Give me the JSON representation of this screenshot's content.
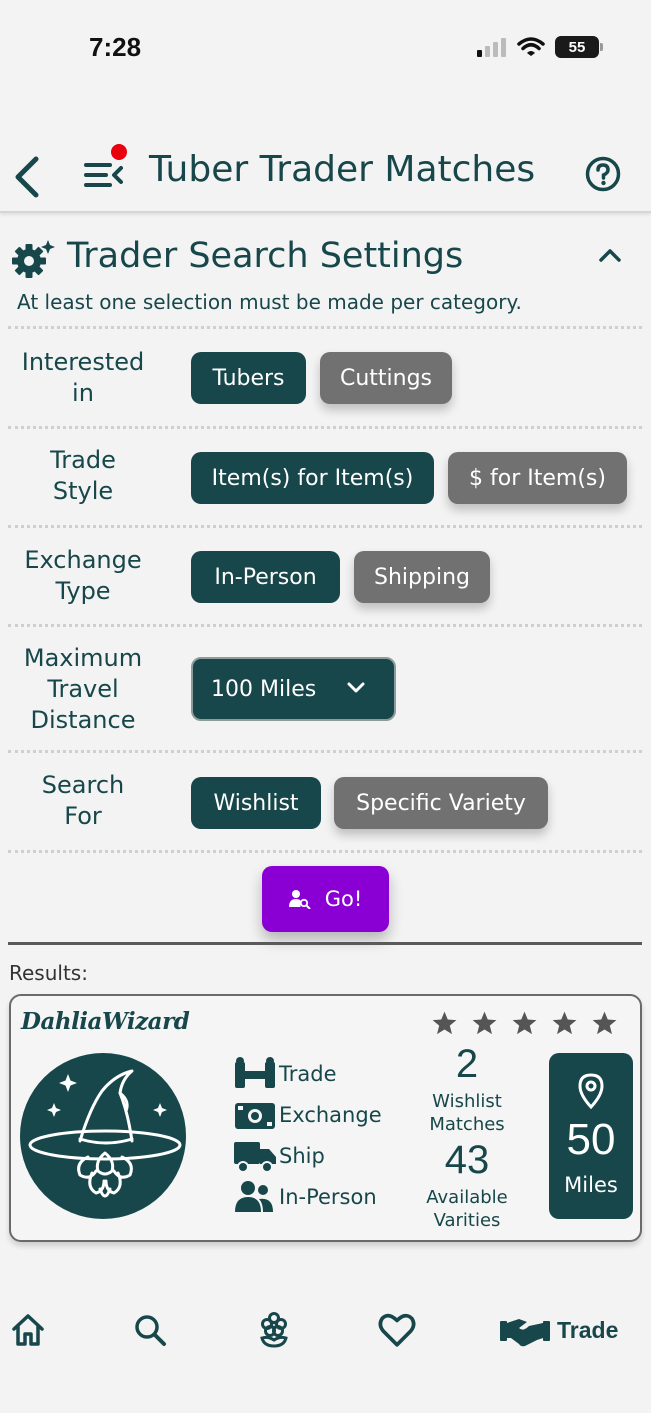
{
  "status_bar": {
    "time": "7:28",
    "battery": "55"
  },
  "header": {
    "title": "Tuber Trader Matches"
  },
  "settings": {
    "title": "Trader Search Settings",
    "note": "At least one selection must be made per category.",
    "rows": {
      "interested": {
        "label_line1": "Interested",
        "label_line2": "in",
        "opt1": "Tubers",
        "opt2": "Cuttings"
      },
      "trade_style": {
        "label_line1": "Trade",
        "label_line2": "Style",
        "opt1": "Item(s) for Item(s)",
        "opt2": "$ for Item(s)"
      },
      "exchange": {
        "label_line1": "Exchange",
        "label_line2": "Type",
        "opt1": "In-Person",
        "opt2": "Shipping"
      },
      "distance": {
        "label_line1": "Maximum",
        "label_line2": "Travel",
        "label_line3": "Distance",
        "selected": "100 Miles"
      },
      "search_for": {
        "label_line1": "Search",
        "label_line2": "For",
        "opt1": "Wishlist",
        "opt2": "Specific Variety"
      }
    },
    "go_label": "Go!"
  },
  "results": {
    "label": "Results:",
    "card": {
      "trader_name": "DahliaWizard",
      "rating_stars": 5,
      "features": {
        "trade": "Trade",
        "exchange": "Exchange",
        "ship": "Ship",
        "in_person": "In-Person"
      },
      "wishlist_matches": "2",
      "wishlist_label_1": "Wishlist",
      "wishlist_label_2": "Matches",
      "available": "43",
      "available_label_1": "Available",
      "available_label_2": "Varities",
      "distance": "50",
      "distance_unit": "Miles"
    }
  },
  "nav": {
    "trade_label": "Trade"
  },
  "colors": {
    "primary": "#17474a",
    "inactive_chip": "#717171",
    "go_button": "#8a00d4",
    "notification_dot": "#e8000d"
  }
}
